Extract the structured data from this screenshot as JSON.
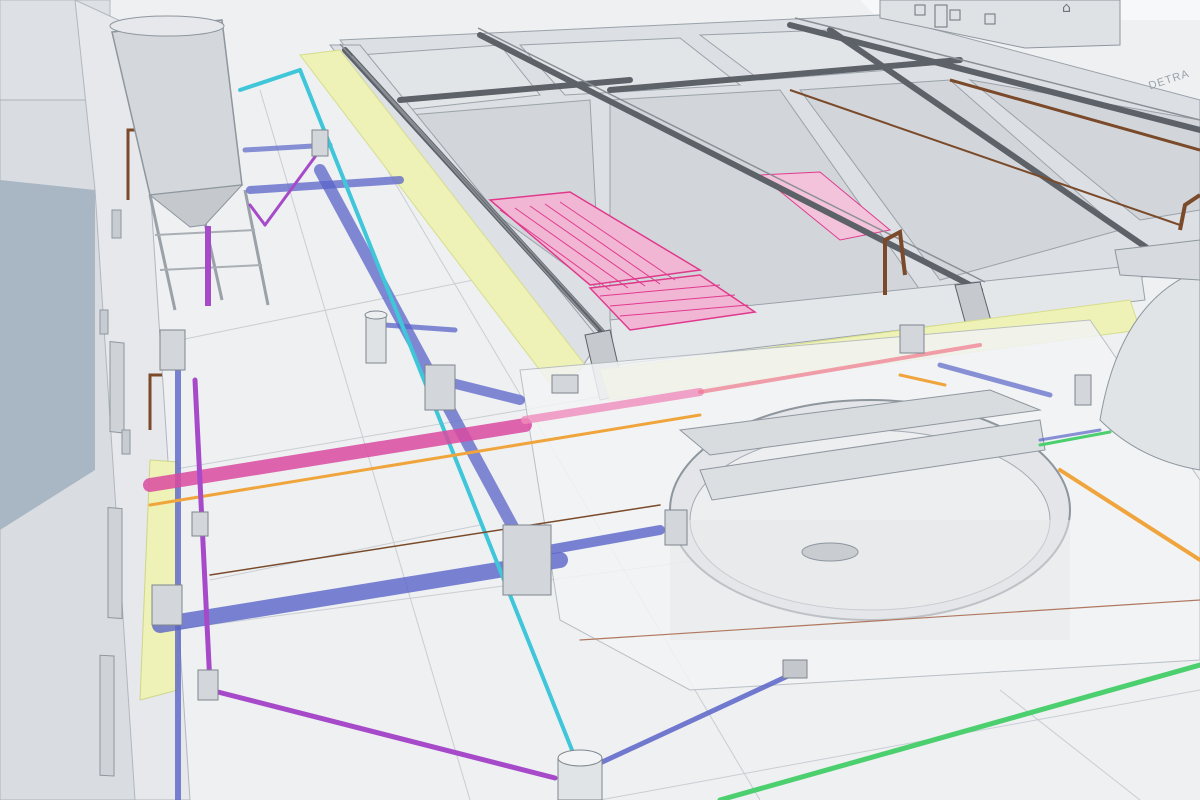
{
  "scene": {
    "description_label": "",
    "watermark_text": "DETRA"
  },
  "palette": {
    "ground": "#eef0f2",
    "building_wall": "#d9dde1",
    "building_dark": "#a9b6c3",
    "tank_wall": "#dcdfe3",
    "tank_floor": "#e8ebee",
    "walkway_yellow": "#eef2b6",
    "walkway_yellow_edge": "#d6dd8c",
    "grating": "#5d6168",
    "diffuser_magenta": "#e03a8c",
    "pipe_purple": "#a64ac9",
    "pipe_blue": "#5a64c8",
    "pipe_cyan": "#3fc6d8",
    "pipe_magenta": "#d94aa0",
    "pipe_orange": "#f0a53c",
    "pipe_green": "#4ccf6e",
    "pipe_brown": "#7a4a2a",
    "clarifier_wall": "#e3e5e8",
    "silo": "#d4d7db"
  },
  "objects": [
    {
      "name": "left-building",
      "label": ""
    },
    {
      "name": "silo",
      "label": ""
    },
    {
      "name": "aeration-basins",
      "label": ""
    },
    {
      "name": "clarifier",
      "label": ""
    },
    {
      "name": "pipe-network",
      "label": ""
    }
  ]
}
